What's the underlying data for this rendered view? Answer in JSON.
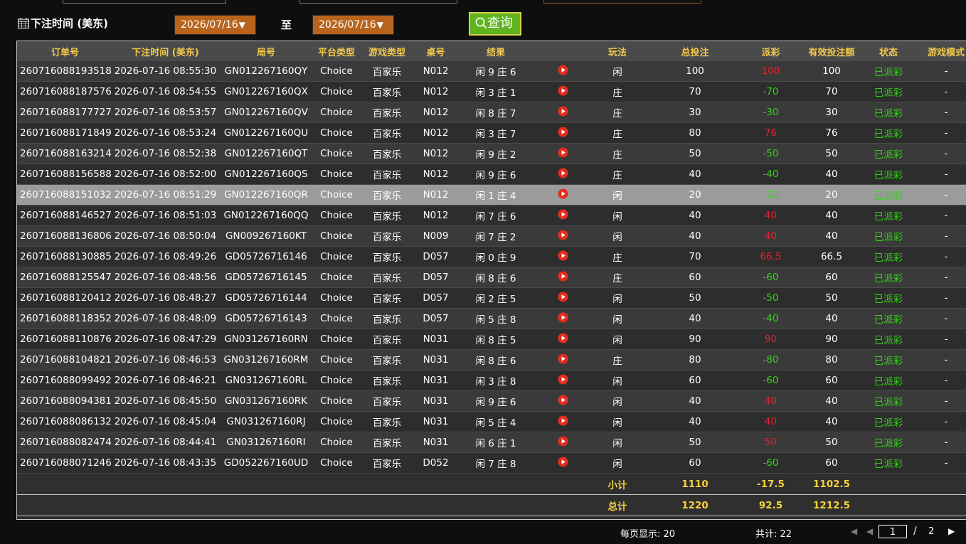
{
  "filter": {
    "label": "下注时间 (美东)",
    "start_date": "2026/07/16",
    "end_date": "2026/07/16",
    "arrow": "▼",
    "to_label": "至",
    "query_label": "查询",
    "calendar_icon": "calendar-icon",
    "search_icon": "search-icon"
  },
  "table": {
    "headers": [
      "订单号",
      "下注时间 (美东)",
      "局号",
      "平台类型",
      "游戏类型",
      "桌号",
      "结果",
      "",
      "玩法",
      "总投注",
      "派彩",
      "有效投注额",
      "状态",
      "游戏模式"
    ],
    "rows": [
      {
        "order": "260716088193518",
        "time": "2026-07-16 08:55:30",
        "round": "GN012267160QY",
        "platform": "Choice",
        "game": "百家乐",
        "table": "N012",
        "result": "闲 9 庄 6",
        "bet": "闲",
        "total": "100",
        "payout": "100",
        "valid": "100",
        "status": "已派彩",
        "mode": "-"
      },
      {
        "order": "260716088187576",
        "time": "2026-07-16 08:54:55",
        "round": "GN012267160QX",
        "platform": "Choice",
        "game": "百家乐",
        "table": "N012",
        "result": "闲 3 庄 1",
        "bet": "庄",
        "total": "70",
        "payout": "-70",
        "valid": "70",
        "status": "已派彩",
        "mode": "-"
      },
      {
        "order": "260716088177727",
        "time": "2026-07-16 08:53:57",
        "round": "GN012267160QV",
        "platform": "Choice",
        "game": "百家乐",
        "table": "N012",
        "result": "闲 8 庄 7",
        "bet": "庄",
        "total": "30",
        "payout": "-30",
        "valid": "30",
        "status": "已派彩",
        "mode": "-"
      },
      {
        "order": "260716088171849",
        "time": "2026-07-16 08:53:24",
        "round": "GN012267160QU",
        "platform": "Choice",
        "game": "百家乐",
        "table": "N012",
        "result": "闲 3 庄 7",
        "bet": "庄",
        "total": "80",
        "payout": "76",
        "valid": "76",
        "status": "已派彩",
        "mode": "-"
      },
      {
        "order": "260716088163214",
        "time": "2026-07-16 08:52:38",
        "round": "GN012267160QT",
        "platform": "Choice",
        "game": "百家乐",
        "table": "N012",
        "result": "闲 9 庄 2",
        "bet": "庄",
        "total": "50",
        "payout": "-50",
        "valid": "50",
        "status": "已派彩",
        "mode": "-"
      },
      {
        "order": "260716088156588",
        "time": "2026-07-16 08:52:00",
        "round": "GN012267160QS",
        "platform": "Choice",
        "game": "百家乐",
        "table": "N012",
        "result": "闲 9 庄 6",
        "bet": "庄",
        "total": "40",
        "payout": "-40",
        "valid": "40",
        "status": "已派彩",
        "mode": "-"
      },
      {
        "order": "260716088151032",
        "time": "2026-07-16 08:51:29",
        "round": "GN012267160QR",
        "platform": "Choice",
        "game": "百家乐",
        "table": "N012",
        "result": "闲 1 庄 4",
        "bet": "闲",
        "total": "20",
        "payout": "-20",
        "valid": "20",
        "status": "已派彩",
        "mode": "-"
      },
      {
        "order": "260716088146527",
        "time": "2026-07-16 08:51:03",
        "round": "GN012267160QQ",
        "platform": "Choice",
        "game": "百家乐",
        "table": "N012",
        "result": "闲 7 庄 6",
        "bet": "闲",
        "total": "40",
        "payout": "40",
        "valid": "40",
        "status": "已派彩",
        "mode": "-"
      },
      {
        "order": "260716088136806",
        "time": "2026-07-16 08:50:04",
        "round": "GN009267160KT",
        "platform": "Choice",
        "game": "百家乐",
        "table": "N009",
        "result": "闲 7 庄 2",
        "bet": "闲",
        "total": "40",
        "payout": "40",
        "valid": "40",
        "status": "已派彩",
        "mode": "-"
      },
      {
        "order": "260716088130885",
        "time": "2026-07-16 08:49:26",
        "round": "GD05726716146",
        "platform": "Choice",
        "game": "百家乐",
        "table": "D057",
        "result": "闲 0 庄 9",
        "bet": "庄",
        "total": "70",
        "payout": "66.5",
        "valid": "66.5",
        "status": "已派彩",
        "mode": "-"
      },
      {
        "order": "260716088125547",
        "time": "2026-07-16 08:48:56",
        "round": "GD05726716145",
        "platform": "Choice",
        "game": "百家乐",
        "table": "D057",
        "result": "闲 8 庄 6",
        "bet": "庄",
        "total": "60",
        "payout": "-60",
        "valid": "60",
        "status": "已派彩",
        "mode": "-"
      },
      {
        "order": "260716088120412",
        "time": "2026-07-16 08:48:27",
        "round": "GD05726716144",
        "platform": "Choice",
        "game": "百家乐",
        "table": "D057",
        "result": "闲 2 庄 5",
        "bet": "闲",
        "total": "50",
        "payout": "-50",
        "valid": "50",
        "status": "已派彩",
        "mode": "-"
      },
      {
        "order": "260716088118352",
        "time": "2026-07-16 08:48:09",
        "round": "GD05726716143",
        "platform": "Choice",
        "game": "百家乐",
        "table": "D057",
        "result": "闲 5 庄 8",
        "bet": "闲",
        "total": "40",
        "payout": "-40",
        "valid": "40",
        "status": "已派彩",
        "mode": "-"
      },
      {
        "order": "260716088110876",
        "time": "2026-07-16 08:47:29",
        "round": "GN031267160RN",
        "platform": "Choice",
        "game": "百家乐",
        "table": "N031",
        "result": "闲 8 庄 5",
        "bet": "闲",
        "total": "90",
        "payout": "90",
        "valid": "90",
        "status": "已派彩",
        "mode": "-"
      },
      {
        "order": "260716088104821",
        "time": "2026-07-16 08:46:53",
        "round": "GN031267160RM",
        "platform": "Choice",
        "game": "百家乐",
        "table": "N031",
        "result": "闲 8 庄 6",
        "bet": "庄",
        "total": "80",
        "payout": "-80",
        "valid": "80",
        "status": "已派彩",
        "mode": "-"
      },
      {
        "order": "260716088099492",
        "time": "2026-07-16 08:46:21",
        "round": "GN031267160RL",
        "platform": "Choice",
        "game": "百家乐",
        "table": "N031",
        "result": "闲 3 庄 8",
        "bet": "闲",
        "total": "60",
        "payout": "-60",
        "valid": "60",
        "status": "已派彩",
        "mode": "-"
      },
      {
        "order": "260716088094381",
        "time": "2026-07-16 08:45:50",
        "round": "GN031267160RK",
        "platform": "Choice",
        "game": "百家乐",
        "table": "N031",
        "result": "闲 9 庄 6",
        "bet": "闲",
        "total": "40",
        "payout": "40",
        "valid": "40",
        "status": "已派彩",
        "mode": "-"
      },
      {
        "order": "260716088086132",
        "time": "2026-07-16 08:45:04",
        "round": "GN031267160RJ",
        "platform": "Choice",
        "game": "百家乐",
        "table": "N031",
        "result": "闲 5 庄 4",
        "bet": "闲",
        "total": "40",
        "payout": "40",
        "valid": "40",
        "status": "已派彩",
        "mode": "-"
      },
      {
        "order": "260716088082474",
        "time": "2026-07-16 08:44:41",
        "round": "GN031267160RI",
        "platform": "Choice",
        "game": "百家乐",
        "table": "N031",
        "result": "闲 6 庄 1",
        "bet": "闲",
        "total": "50",
        "payout": "50",
        "valid": "50",
        "status": "已派彩",
        "mode": "-"
      },
      {
        "order": "260716088071246",
        "time": "2026-07-16 08:43:35",
        "round": "GD052267160UD",
        "platform": "Choice",
        "game": "百家乐",
        "table": "D052",
        "result": "闲 7 庄 8",
        "bet": "闲",
        "total": "60",
        "payout": "-60",
        "valid": "60",
        "status": "已派彩",
        "mode": "-"
      }
    ],
    "highlighted_row_index": 6,
    "play_icon": "play-video-icon",
    "subtotal": {
      "label": "小计",
      "total": "1110",
      "payout": "-17.5",
      "valid": "1102.5"
    },
    "grand_total": {
      "label": "总计",
      "total": "1220",
      "payout": "92.5",
      "valid": "1212.5"
    }
  },
  "pagination": {
    "per_page": "每页显示: 20",
    "total": "共计: 22",
    "current_page": "1",
    "separator": "/",
    "page_count": "2",
    "first_icon": "first-page-icon",
    "prev_icon": "prev-page-icon",
    "next_icon": "next-page-icon"
  },
  "colors": {
    "header_text": "#f2c94c",
    "win": "#e8222a",
    "loss": "#35d21b",
    "status": "#35d21b",
    "date_select_bg": "#b8641c",
    "query_bg": "#5fb41f"
  }
}
